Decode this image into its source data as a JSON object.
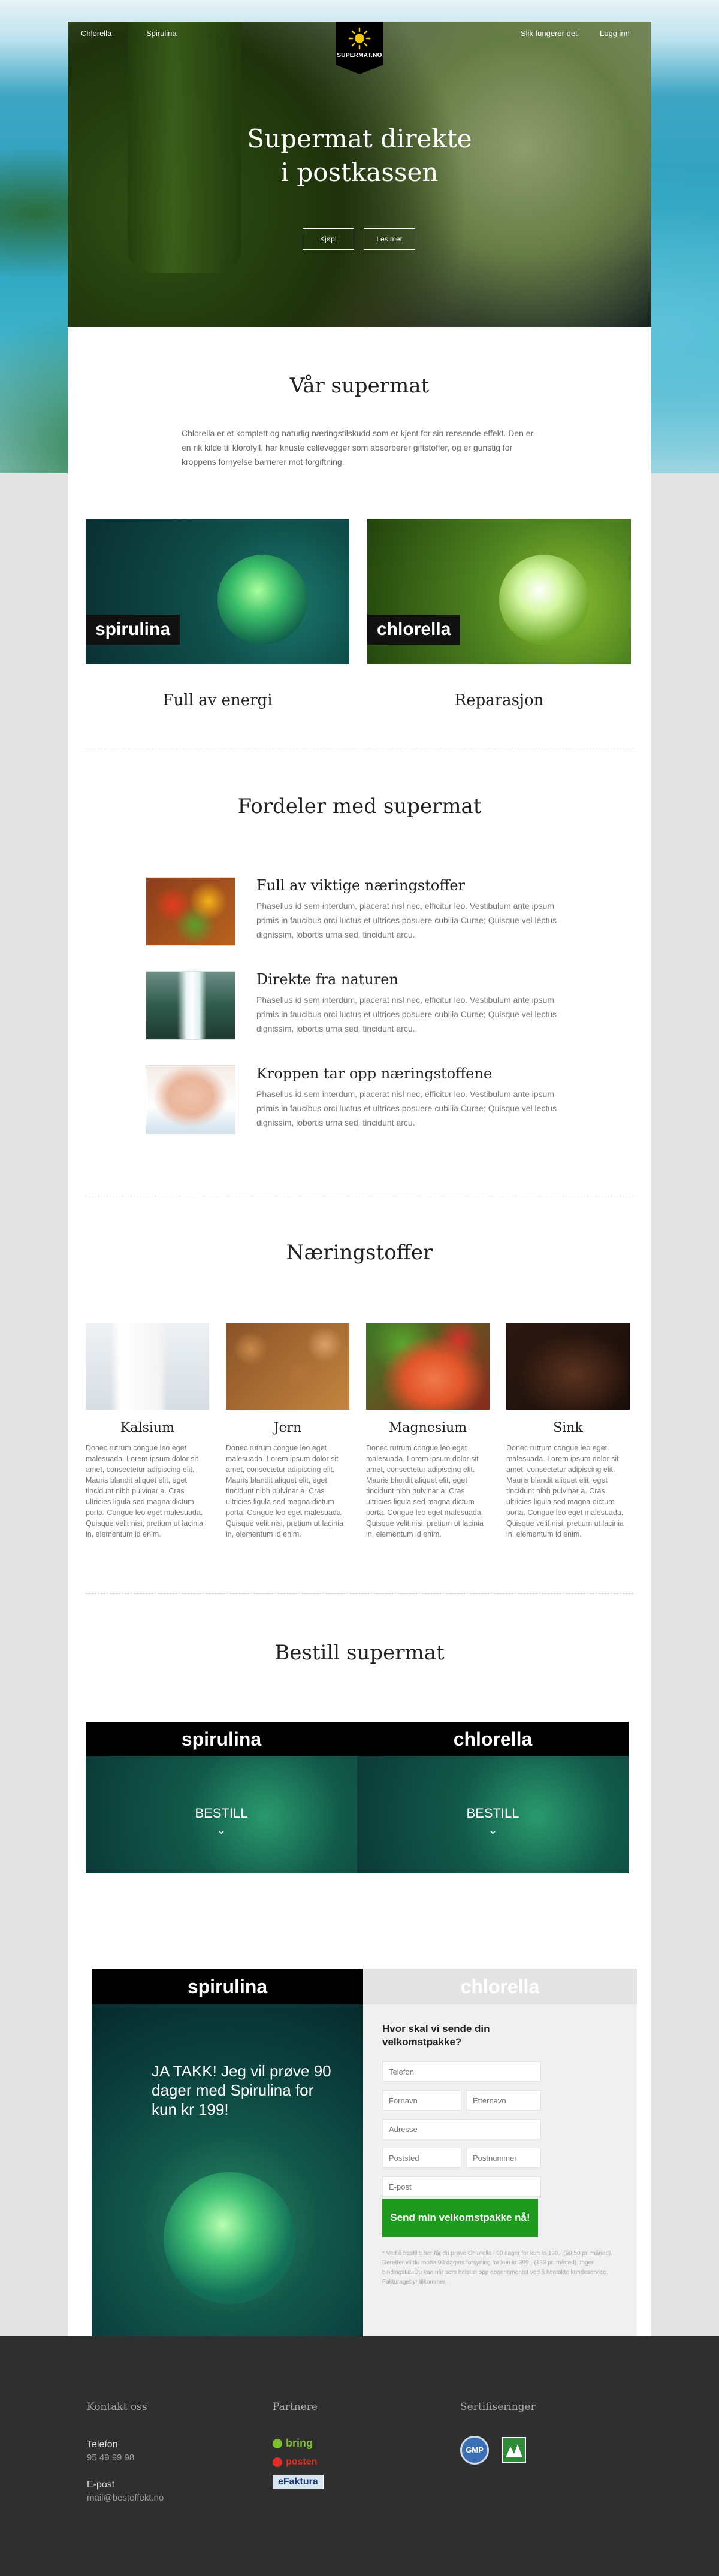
{
  "nav": {
    "left": [
      "Chlorella",
      "Spirulina"
    ],
    "right": [
      "Slik fungerer det",
      "Logg inn"
    ],
    "logo_text": "SUPERMAT.NO"
  },
  "hero": {
    "title_line1": "Supermat direkte",
    "title_line2": "i postkassen",
    "btn_buy": "Kjøp!",
    "btn_read": "Les mer"
  },
  "intro": {
    "title": "Vår supermat",
    "text": "Chlorella er et komplett og naturlig næringstilskudd som er kjent for sin rensende effekt. Den er en rik kilde til klorofyll, har knuste cellevegger som absorberer giftstoffer, og er gunstig for kroppens fornyelse barrierer mot forgiftning."
  },
  "products": [
    {
      "tag": "spirulina",
      "caption": "Full av energi"
    },
    {
      "tag": "chlorella",
      "caption": "Reparasjon"
    }
  ],
  "benefits": {
    "title": "Fordeler med supermat",
    "items": [
      {
        "title": "Full av viktige næringstoffer",
        "text": "Phasellus id sem interdum, placerat nisl nec, efficitur leo. Vestibulum ante ipsum primis in faucibus orci luctus et ultrices posuere cubilia Curae; Quisque vel lectus dignissim, lobortis urna sed, tincidunt arcu."
      },
      {
        "title": "Direkte fra naturen",
        "text": "Phasellus id sem interdum, placerat nisl nec, efficitur leo. Vestibulum ante ipsum primis in faucibus orci luctus et ultrices posuere cubilia Curae; Quisque vel lectus dignissim, lobortis urna sed, tincidunt arcu."
      },
      {
        "title": "Kroppen tar opp næringstoffene",
        "text": "Phasellus id sem interdum, placerat nisl nec, efficitur leo. Vestibulum ante ipsum primis in faucibus orci luctus et ultrices posuere cubilia Curae; Quisque vel lectus dignissim, lobortis urna sed, tincidunt arcu."
      }
    ]
  },
  "nutrients": {
    "title": "Næringstoffer",
    "items": [
      {
        "name": "Kalsium",
        "text": "Donec rutrum congue leo eget malesuada. Lorem ipsum dolor sit amet, consectetur adipiscing elit. Mauris blandit aliquet elit, eget tincidunt nibh pulvinar a. Cras ultricies ligula sed magna dictum porta. Congue leo eget malesuada. Quisque velit nisi, pretium ut lacinia in, elementum id enim."
      },
      {
        "name": "Jern",
        "text": "Donec rutrum congue leo eget malesuada. Lorem ipsum dolor sit amet, consectetur adipiscing elit. Mauris blandit aliquet elit, eget tincidunt nibh pulvinar a. Cras ultricies ligula sed magna dictum porta. Congue leo eget malesuada. Quisque velit nisi, pretium ut lacinia in, elementum id enim."
      },
      {
        "name": "Magnesium",
        "text": "Donec rutrum congue leo eget malesuada. Lorem ipsum dolor sit amet, consectetur adipiscing elit. Mauris blandit aliquet elit, eget tincidunt nibh pulvinar a. Cras ultricies ligula sed magna dictum porta. Congue leo eget malesuada. Quisque velit nisi, pretium ut lacinia in, elementum id enim."
      },
      {
        "name": "Sink",
        "text": "Donec rutrum congue leo eget malesuada. Lorem ipsum dolor sit amet, consectetur adipiscing elit. Mauris blandit aliquet elit, eget tincidunt nibh pulvinar a. Cras ultricies ligula sed magna dictum porta. Congue leo eget malesuada. Quisque velit nisi, pretium ut lacinia in, elementum id enim."
      }
    ]
  },
  "order": {
    "title": "Bestill supermat",
    "panels": [
      {
        "brand": "spirulina",
        "cta": "BESTILL",
        "chevron": "⌄"
      },
      {
        "brand": "chlorella",
        "cta": "BESTILL",
        "chevron": "⌄"
      }
    ]
  },
  "kit": {
    "tab_active": "spirulina",
    "tab_inactive": "chlorella",
    "offer": "JA TAKK! Jeg vil prøve 90 dager med Spirulina for kun kr 199!",
    "question": "Hvor skal vi sende din velkomstpakke?",
    "fields": {
      "phone": "Telefon",
      "first": "Fornavn",
      "last": "Etternavn",
      "address": "Adresse",
      "postcode": "Poststed",
      "postnr": "Postnummer",
      "email": "E-post"
    },
    "submit": "Send min velkomstpakke nå!",
    "fine_print": "* Ved å bestille her får du prøve Chlorella i 90 dager for kun kr 199,- (99,50 pr. måned). Deretter vil du motta 90 dagers forsyning for kun kr 399,- (133 pr. måned). Ingen bindingstid. Du kan når som helst si opp abonnementet ved å kontakte kundeservice. Fakturagebyr tilkommer."
  },
  "footer": {
    "contact_title": "Kontakt oss",
    "phone_label": "Telefon",
    "phone": "95 49 99 98",
    "email_label": "E-post",
    "email": "mail@besteffekt.no",
    "partners_title": "Partnere",
    "partners": [
      "bring",
      "posten",
      "eFaktura"
    ],
    "certs_title": "Sertifiseringer",
    "certs": [
      "GMP",
      "Debio"
    ]
  },
  "colors": {
    "accent_green": "#1d9a1d",
    "brand_black": "#000000",
    "footer_bg": "#2f2f2f"
  }
}
